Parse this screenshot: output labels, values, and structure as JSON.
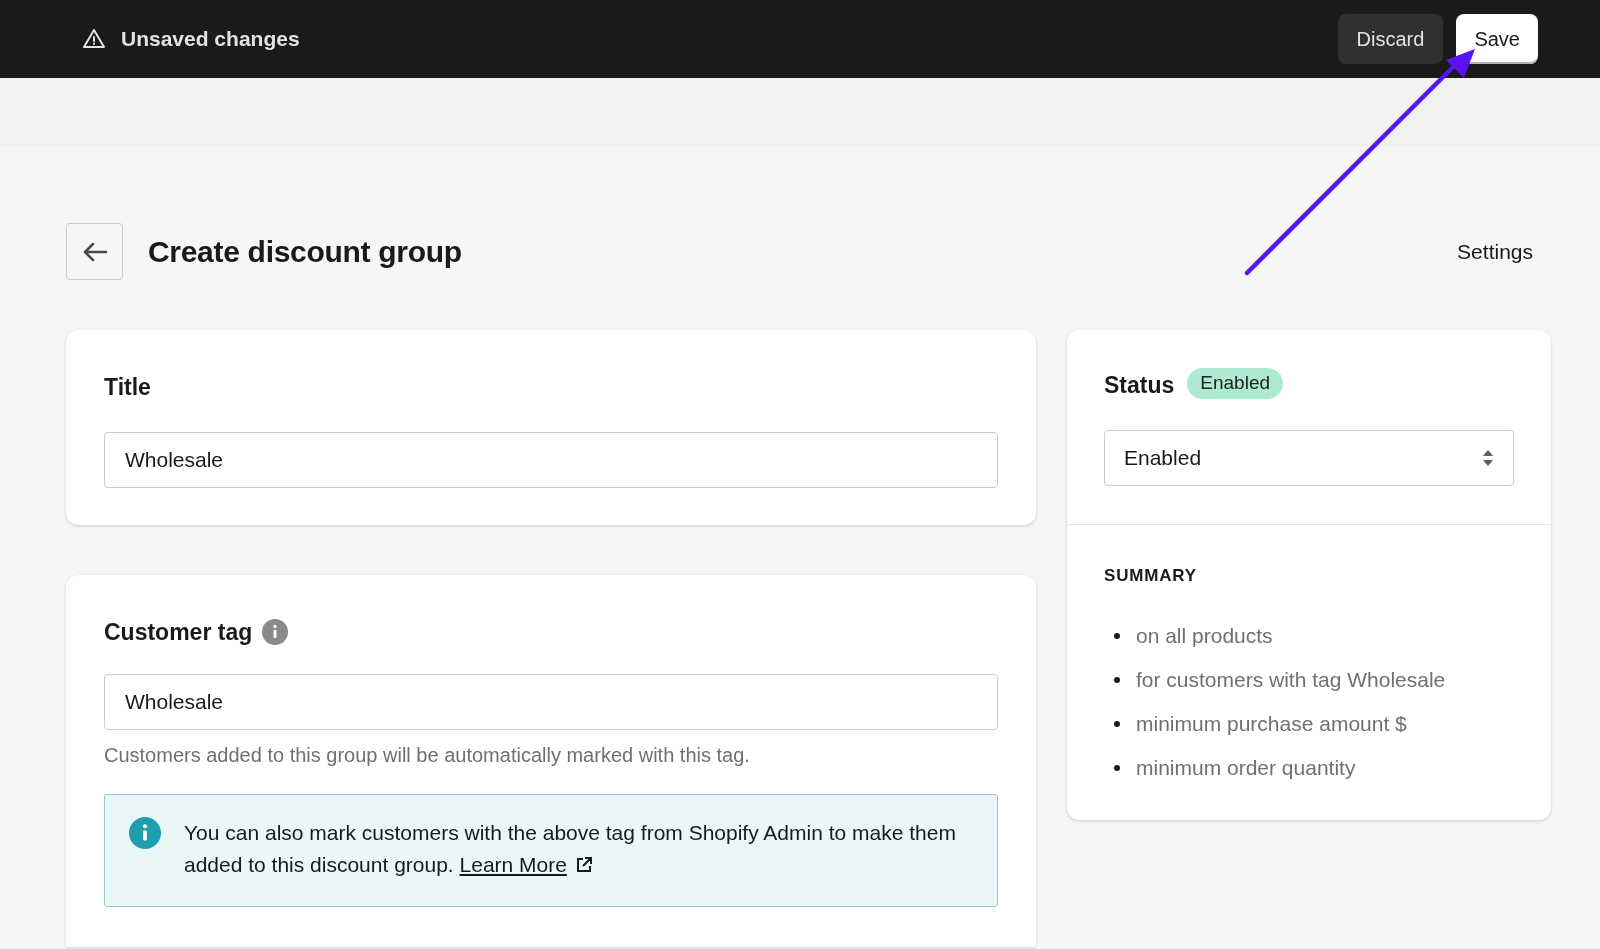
{
  "top_bar": {
    "message": "Unsaved changes",
    "buttons": [
      {
        "label": "Discard",
        "kind": "secondary"
      },
      {
        "label": "Save",
        "kind": "primary"
      }
    ]
  },
  "header": {
    "title": "Create discount group",
    "settings_link": "Settings"
  },
  "title_card": {
    "heading": "Title",
    "value": "Wholesale"
  },
  "customer_tag_card": {
    "heading": "Customer tag",
    "value": "Wholesale",
    "help": "Customers added to this group will be automatically marked with this tag.",
    "info": {
      "text": "You can also mark customers with the above tag from Shopify Admin to make them added to this discount group.",
      "link": "Learn More"
    }
  },
  "status_card": {
    "heading": "Status",
    "badge": "Enabled",
    "select_value": "Enabled",
    "summary_heading": "SUMMARY",
    "summary_items": [
      "on all products",
      "for customers with tag Wholesale",
      "minimum purchase amount $",
      "minimum order quantity"
    ]
  }
}
